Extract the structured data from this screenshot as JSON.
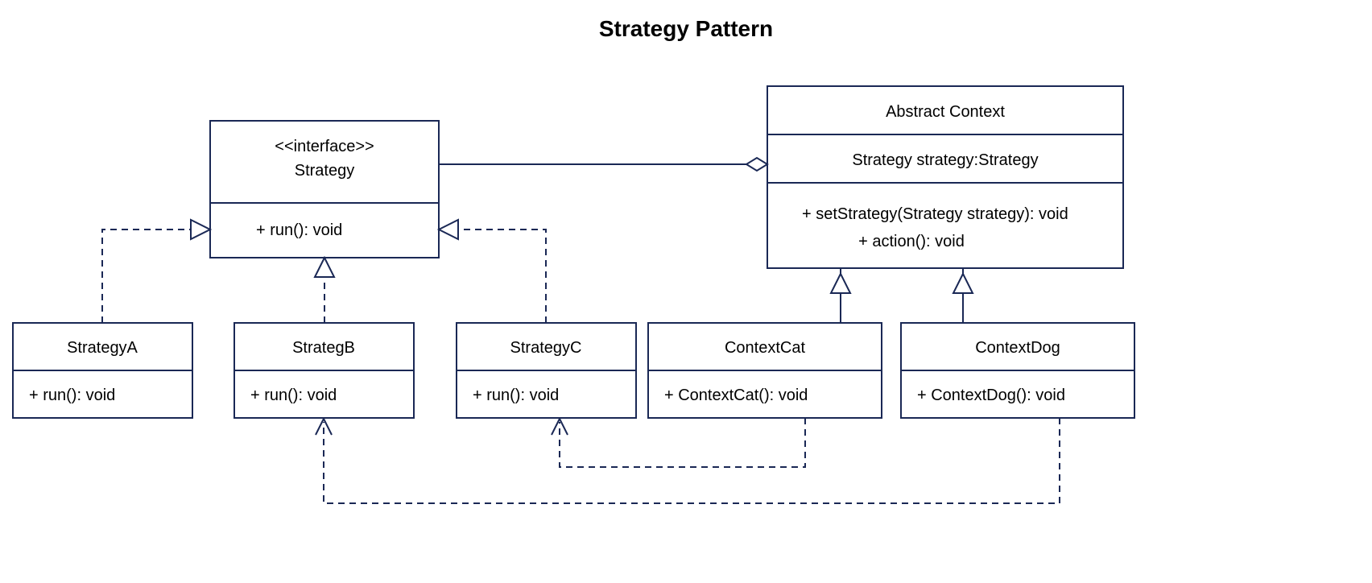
{
  "title": "Strategy Pattern",
  "strategy": {
    "stereotype": "<<interface>>",
    "name": "Strategy",
    "method": "+   run(): void"
  },
  "abstractContext": {
    "name": "Abstract Context",
    "attr": "Strategy strategy:Strategy",
    "m1": "+   setStrategy(Strategy strategy): void",
    "m2": "+   action(): void"
  },
  "strategyA": {
    "name": "StrategyA",
    "method": "+   run(): void"
  },
  "strategyB": {
    "name": "StrategB",
    "method": "+   run(): void"
  },
  "strategyC": {
    "name": "StrategyC",
    "method": "+   run(): void"
  },
  "contextCat": {
    "name": "ContextCat",
    "method": "+   ContextCat(): void"
  },
  "contextDog": {
    "name": "ContextDog",
    "method": "+   ContextDog(): void"
  }
}
